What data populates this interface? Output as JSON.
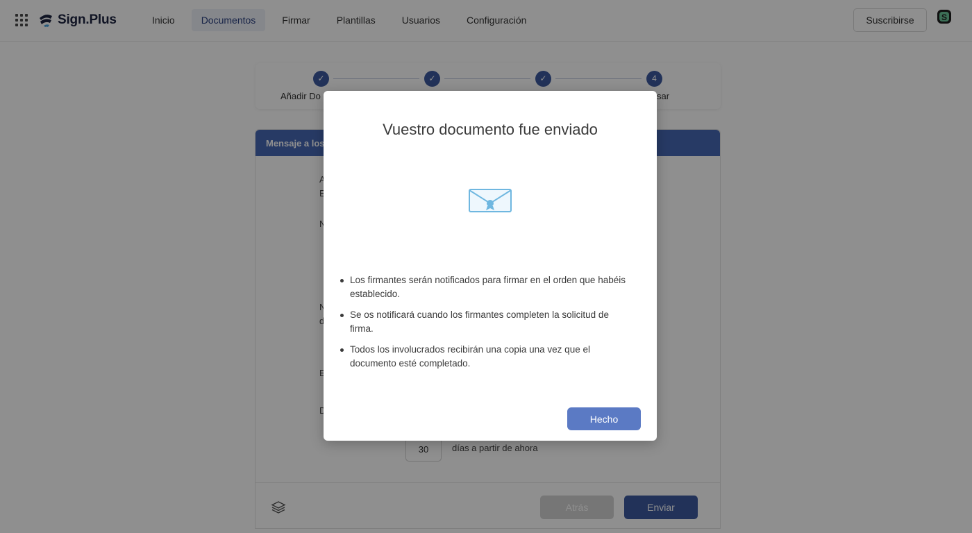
{
  "header": {
    "logo_text": "Sign.Plus",
    "nav": [
      "Inicio",
      "Documentos",
      "Firmar",
      "Plantillas",
      "Usuarios",
      "Configuración"
    ],
    "active_nav": "Documentos",
    "subscribe_label": "Suscribirse"
  },
  "stepper": {
    "steps": [
      {
        "label": "Añadir Do",
        "state": "done"
      },
      {
        "label": "",
        "state": "done"
      },
      {
        "label": "",
        "state": "done"
      },
      {
        "number": "4",
        "label": "sar",
        "state": "current"
      }
    ]
  },
  "form": {
    "header_title": "Mensaje a los",
    "fragments": [
      "A",
      "E",
      "N",
      "N",
      "d",
      "E",
      "D"
    ],
    "days_value": "30",
    "days_suffix": "días a partir de ahora",
    "back_label": "Atrás",
    "send_label": "Enviar"
  },
  "modal": {
    "title": "Vuestro documento fue enviado",
    "bullets": [
      "Los firmantes serán notificados para firmar en el orden que habéis establecido.",
      "Se os notificará cuando los firmantes completen la solicitud de firma.",
      "Todos los involucrados recibirán una copia una vez que el documento esté completado."
    ],
    "done_label": "Hecho"
  },
  "colors": {
    "brand": "#3d5a9f",
    "header_bar": "#4668b4",
    "done_button": "#5b7ac4",
    "envelope": "#6fb7e0"
  }
}
